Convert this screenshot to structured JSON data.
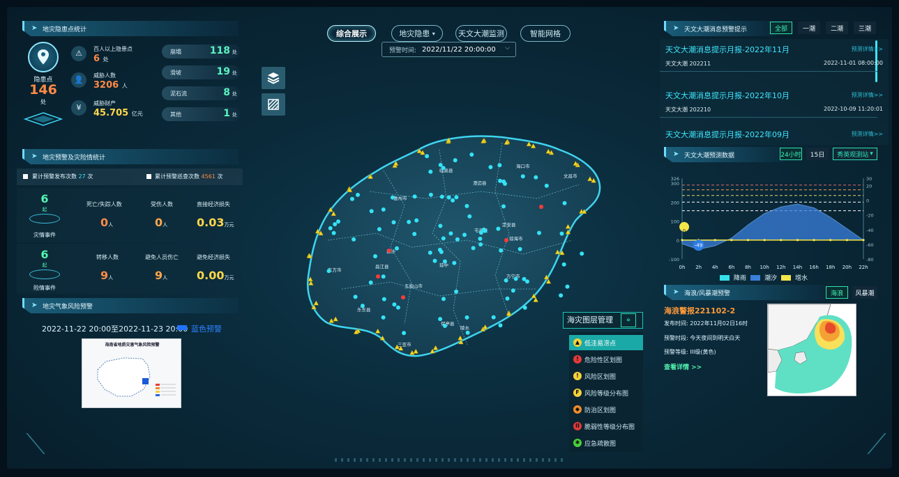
{
  "nav": {
    "tabs": [
      {
        "label": "综合展示"
      },
      {
        "label": "地灾隐患"
      },
      {
        "label": "天文大潮监测"
      },
      {
        "label": "智能网格"
      }
    ],
    "dropdown_caret": "▾"
  },
  "forecast_time": {
    "label": "预警时间:",
    "value": "2022/11/22 20:00:00"
  },
  "hazard_stats": {
    "title": "地灾隐患点统计",
    "points_label": "隐患点",
    "points_count": "146",
    "points_unit": "处",
    "items": [
      {
        "label": "百人以上隐患点",
        "value": "6",
        "unit": "处"
      },
      {
        "label": "威胁人数",
        "value": "3206",
        "unit": "人"
      },
      {
        "label": "威胁财产",
        "value": "45.705",
        "unit": "亿元"
      }
    ],
    "types": [
      {
        "label": "崩塌",
        "value": "118",
        "unit": "处"
      },
      {
        "label": "滑坡",
        "value": "19",
        "unit": "处"
      },
      {
        "label": "泥石流",
        "value": "8",
        "unit": "处"
      },
      {
        "label": "其他",
        "value": "1",
        "unit": "处"
      }
    ]
  },
  "warning_stats": {
    "title": "地灾预警及灾险情统计",
    "issued_label": "累计预警发布次数",
    "issued_value": "27",
    "issued_unit": "次",
    "patrol_label": "累计预警巡查次数",
    "patrol_value": "4561",
    "patrol_unit": "次",
    "disaster": {
      "count": "6",
      "unit": "起",
      "label": "灾情事件",
      "cols": [
        {
          "label": "死亡/失踪人数",
          "value": "0",
          "unit": "人"
        },
        {
          "label": "受伤人数",
          "value": "0",
          "unit": "人"
        },
        {
          "label": "直接经济损失",
          "value": "0.03",
          "unit": "万元"
        }
      ]
    },
    "danger": {
      "count": "6",
      "unit": "起",
      "label": "险情事件",
      "cols": [
        {
          "label": "转移人数",
          "value": "9",
          "unit": "人"
        },
        {
          "label": "避免人员伤亡",
          "value": "9",
          "unit": "人"
        },
        {
          "label": "避免经济损失",
          "value": "0.00",
          "unit": "万元"
        }
      ]
    }
  },
  "meteo": {
    "title": "地灾气象风险预警",
    "period": "2022-11-22 20:00至2022-11-23 20:00",
    "level": "蓝色预警",
    "map_title": "海南省地质灾害气象风险预警"
  },
  "tide_notice": {
    "title": "天文大潮消息预警提示",
    "filters": [
      "全部",
      "一潮",
      "二潮",
      "三潮"
    ],
    "messages": [
      {
        "title": "天文大潮消息提示月报-2022年11月",
        "detail": "预测详情>>",
        "sub": "天文大潮 202211",
        "date": "2022-11-01 08:00:00"
      },
      {
        "title": "天文大潮消息提示月报-2022年10月",
        "detail": "预测详情>>",
        "sub": "天文大潮 202210",
        "date": "2022-10-09 11:20:01"
      },
      {
        "title": "天文大潮消息提示月报-2022年09月",
        "detail": "预测详情>>"
      }
    ]
  },
  "tide_forecast": {
    "title": "天文大潮预测数据",
    "ranges": [
      "24小时",
      "15日"
    ],
    "station": "秀英观测站",
    "legend": [
      "降雨",
      "潮汐",
      "增水"
    ],
    "marker_a": "0",
    "marker_b": "-49"
  },
  "chart_data": {
    "type": "area",
    "x": [
      "0h",
      "2h",
      "4h",
      "6h",
      "8h",
      "10h",
      "12h",
      "14h",
      "16h",
      "18h",
      "20h",
      "22h"
    ],
    "y_left_ticks": [
      "326",
      "300",
      "200",
      "100",
      "0",
      "-100"
    ],
    "y_left_range": [
      -100,
      326
    ],
    "y_right_ticks": [
      "30",
      "20",
      "0",
      "-20",
      "-40",
      "-60",
      "-80"
    ],
    "y_right_range": [
      -80,
      30
    ],
    "series": [
      {
        "name": "降雨",
        "color": "#36e0ea",
        "values": [
          0,
          0,
          0,
          0,
          0,
          0,
          0,
          0,
          0,
          0,
          0,
          0
        ]
      },
      {
        "name": "潮汐",
        "color": "#3a7fdc",
        "values": [
          -20,
          -49,
          -30,
          10,
          80,
          140,
          175,
          190,
          170,
          120,
          60,
          0
        ]
      },
      {
        "name": "增水",
        "color": "#f5e74a",
        "values": [
          0,
          0,
          0,
          0,
          0,
          0,
          0,
          0,
          0,
          0,
          0,
          0
        ]
      }
    ],
    "threshold_lines": [
      {
        "value": 290,
        "color": "#e36a6a"
      },
      {
        "value": 265,
        "color": "#f0a050"
      },
      {
        "value": 235,
        "color": "#e9d86a"
      },
      {
        "value": 200,
        "color": "#ffffff"
      },
      {
        "value": 155,
        "color": "#ffffff"
      }
    ]
  },
  "wave": {
    "title": "海浪/风暴潮预警",
    "tabs": [
      "海浪",
      "风暴潮"
    ],
    "report": "海浪警报221102-2",
    "rows": [
      {
        "label": "发布时间:",
        "value": "2022年11月02日16时"
      },
      {
        "label": "预警时段:",
        "value": "今天夜间到明天白天"
      },
      {
        "label": "预警等级:",
        "value": "III级(黄色)"
      }
    ],
    "more": "查看详情 >>"
  },
  "layers": {
    "title": "海灾图层管理",
    "items": [
      {
        "label": "低洼易涝点",
        "color": "#f5d23a",
        "icon": "▲",
        "selected": true
      },
      {
        "label": "危险性区划图",
        "color": "#e23a3a",
        "icon": "!",
        "selected": false
      },
      {
        "label": "风险区划图",
        "color": "#f5d23a",
        "icon": "!",
        "selected": false
      },
      {
        "label": "风险等级分布图",
        "color": "#f5d23a",
        "icon": "F",
        "selected": false
      },
      {
        "label": "防治区划图",
        "color": "#f08c2a",
        "icon": "◆",
        "selected": false
      },
      {
        "label": "脆弱性等级分布图",
        "color": "#e23a3a",
        "icon": "II",
        "selected": false
      },
      {
        "label": "应急疏散图",
        "color": "#4ad03a",
        "icon": "✱",
        "selected": false
      }
    ]
  },
  "map_labels": [
    "临高县",
    "澄迈县",
    "海口市",
    "文昌市",
    "儋州市",
    "屯昌县",
    "定安县",
    "白沙",
    "琼海市",
    "昌江县",
    "东方市",
    "琼中",
    "五指山市",
    "万宁市",
    "乐东县",
    "保亭县",
    "陵水",
    "三亚市"
  ]
}
